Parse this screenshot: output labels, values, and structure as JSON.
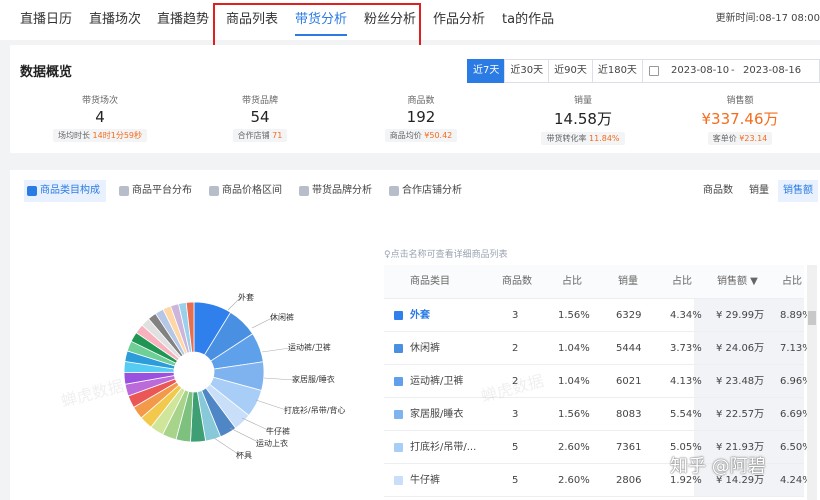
{
  "nav": {
    "tabs": [
      "直播日历",
      "直播场次",
      "直播趋势",
      "商品列表",
      "带货分析",
      "粉丝分析",
      "作品分析",
      "ta的作品"
    ],
    "active_index": 4,
    "update_time": "更新时间:08-17 08:00"
  },
  "overview": {
    "title": "数据概览",
    "day_buttons": [
      "近7天",
      "近30天",
      "近90天",
      "近180天"
    ],
    "active_day": 0,
    "date_start": "2023-08-10",
    "date_sep": "-",
    "date_end": "2023-08-16",
    "stats": [
      {
        "label": "带货场次",
        "value": "4",
        "sub_label": "场均时长",
        "sub_value": "14时1分59秒"
      },
      {
        "label": "带货品牌",
        "value": "54",
        "sub_label": "合作店铺",
        "sub_value": "71"
      },
      {
        "label": "商品数",
        "value": "192",
        "sub_label": "商品均价",
        "sub_value": "¥50.42"
      },
      {
        "label": "销量",
        "value": "14.58万",
        "sub_label": "带货转化率",
        "sub_value": "11.84%"
      },
      {
        "label": "销售额",
        "value": "¥337.46万",
        "sub_label": "客单价",
        "sub_value": "¥23.14"
      }
    ]
  },
  "analysis": {
    "tabs": [
      "商品类目构成",
      "商品平台分布",
      "商品价格区间",
      "带货品牌分析",
      "合作店铺分析"
    ],
    "metrics": [
      "商品数",
      "销量",
      "销售额"
    ],
    "active_metric": 2,
    "hint": "点击名称可查看详细商品列表",
    "columns": [
      "商品类目",
      "商品数",
      "占比",
      "销量",
      "占比",
      "销售额 ▼",
      "占比"
    ],
    "rows": [
      {
        "name": "外套",
        "count": "3",
        "count_pct": "1.56%",
        "sales": "6329",
        "sales_pct": "4.34%",
        "revenue": "¥ 29.99万",
        "revenue_pct": "8.89%",
        "color": "#2f80ed"
      },
      {
        "name": "休闲裤",
        "count": "2",
        "count_pct": "1.04%",
        "sales": "5444",
        "sales_pct": "3.73%",
        "revenue": "¥ 24.06万",
        "revenue_pct": "7.13%",
        "color": "#4a90e2"
      },
      {
        "name": "运动裤/卫裤",
        "count": "2",
        "count_pct": "1.04%",
        "sales": "6021",
        "sales_pct": "4.13%",
        "revenue": "¥ 23.48万",
        "revenue_pct": "6.96%",
        "color": "#5fa0ea"
      },
      {
        "name": "家居服/睡衣",
        "count": "3",
        "count_pct": "1.56%",
        "sales": "8083",
        "sales_pct": "5.54%",
        "revenue": "¥ 22.57万",
        "revenue_pct": "6.69%",
        "color": "#7fb3ef"
      },
      {
        "name": "打底衫/吊带/...",
        "count": "5",
        "count_pct": "2.60%",
        "sales": "7361",
        "sales_pct": "5.05%",
        "revenue": "¥ 21.93万",
        "revenue_pct": "6.50%",
        "color": "#a8cdf6"
      },
      {
        "name": "牛仔裤",
        "count": "5",
        "count_pct": "2.60%",
        "sales": "2806",
        "sales_pct": "1.92%",
        "revenue": "¥ 14.29万",
        "revenue_pct": "4.24%",
        "color": "#c9def8"
      }
    ],
    "pie_labels": [
      "外套",
      "休闲裤",
      "运动裤/卫裤",
      "家居服/睡衣",
      "打底衫/吊带/背心",
      "牛仔裤",
      "运动上衣",
      "杯具"
    ],
    "pie_slices": [
      {
        "value": 8.89,
        "color": "#2f80ed"
      },
      {
        "value": 7.13,
        "color": "#4a90e2"
      },
      {
        "value": 6.96,
        "color": "#5fa0ea"
      },
      {
        "value": 6.69,
        "color": "#7fb3ef"
      },
      {
        "value": 6.5,
        "color": "#a8cdf6"
      },
      {
        "value": 4.24,
        "color": "#c9def8"
      },
      {
        "value": 4.0,
        "color": "#4f86c6"
      },
      {
        "value": 3.6,
        "color": "#87c9d8"
      },
      {
        "value": 3.5,
        "color": "#3d9f73"
      },
      {
        "value": 3.4,
        "color": "#7ec07e"
      },
      {
        "value": 3.3,
        "color": "#a7d48a"
      },
      {
        "value": 3.2,
        "color": "#cfe59a"
      },
      {
        "value": 3.1,
        "color": "#f2c94c"
      },
      {
        "value": 3.0,
        "color": "#f2994a"
      },
      {
        "value": 2.9,
        "color": "#eb5757"
      },
      {
        "value": 2.8,
        "color": "#bb6bd9"
      },
      {
        "value": 2.7,
        "color": "#9b51e0"
      },
      {
        "value": 2.6,
        "color": "#56ccf2"
      },
      {
        "value": 2.5,
        "color": "#2d9cdb"
      },
      {
        "value": 2.4,
        "color": "#6fcf97"
      },
      {
        "value": 2.3,
        "color": "#219653"
      },
      {
        "value": 2.2,
        "color": "#f7b2bd"
      },
      {
        "value": 2.1,
        "color": "#e0e0e0"
      },
      {
        "value": 2.0,
        "color": "#828282"
      },
      {
        "value": 2.0,
        "color": "#b4c7e7"
      },
      {
        "value": 1.9,
        "color": "#ffd6a5"
      },
      {
        "value": 1.9,
        "color": "#cdb4db"
      },
      {
        "value": 1.8,
        "color": "#9ad0ec"
      },
      {
        "value": 1.8,
        "color": "#e76f51"
      }
    ]
  },
  "watermark": {
    "text": "蝉虎数据"
  },
  "footer": {
    "credit": "知乎 @阿碧"
  }
}
